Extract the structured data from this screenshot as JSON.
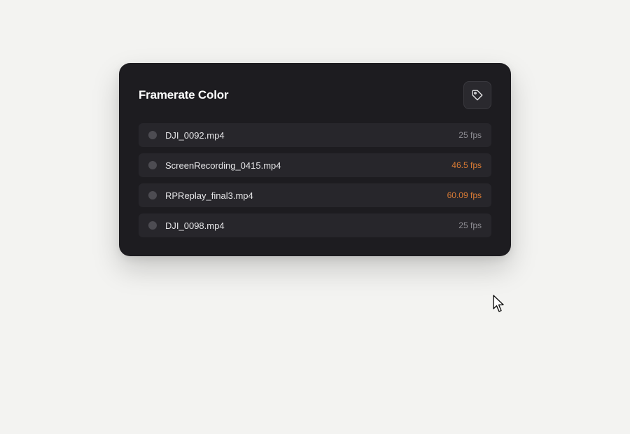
{
  "card": {
    "title": "Framerate Color",
    "action_icon": "tag-icon"
  },
  "files": [
    {
      "name": "DJI_0092.mp4",
      "fps": "25 fps",
      "highlight": false
    },
    {
      "name": "ScreenRecording_0415.mp4",
      "fps": "46.5 fps",
      "highlight": true
    },
    {
      "name": "RPReplay_final3.mp4",
      "fps": "60.09 fps",
      "highlight": true
    },
    {
      "name": "DJI_0098.mp4",
      "fps": "25 fps",
      "highlight": false
    }
  ],
  "colors": {
    "background": "#f3f3f1",
    "card": "#1d1c20",
    "row": "#27262b",
    "accent_fps": "#d97b35",
    "normal_fps": "#8d8c92"
  }
}
